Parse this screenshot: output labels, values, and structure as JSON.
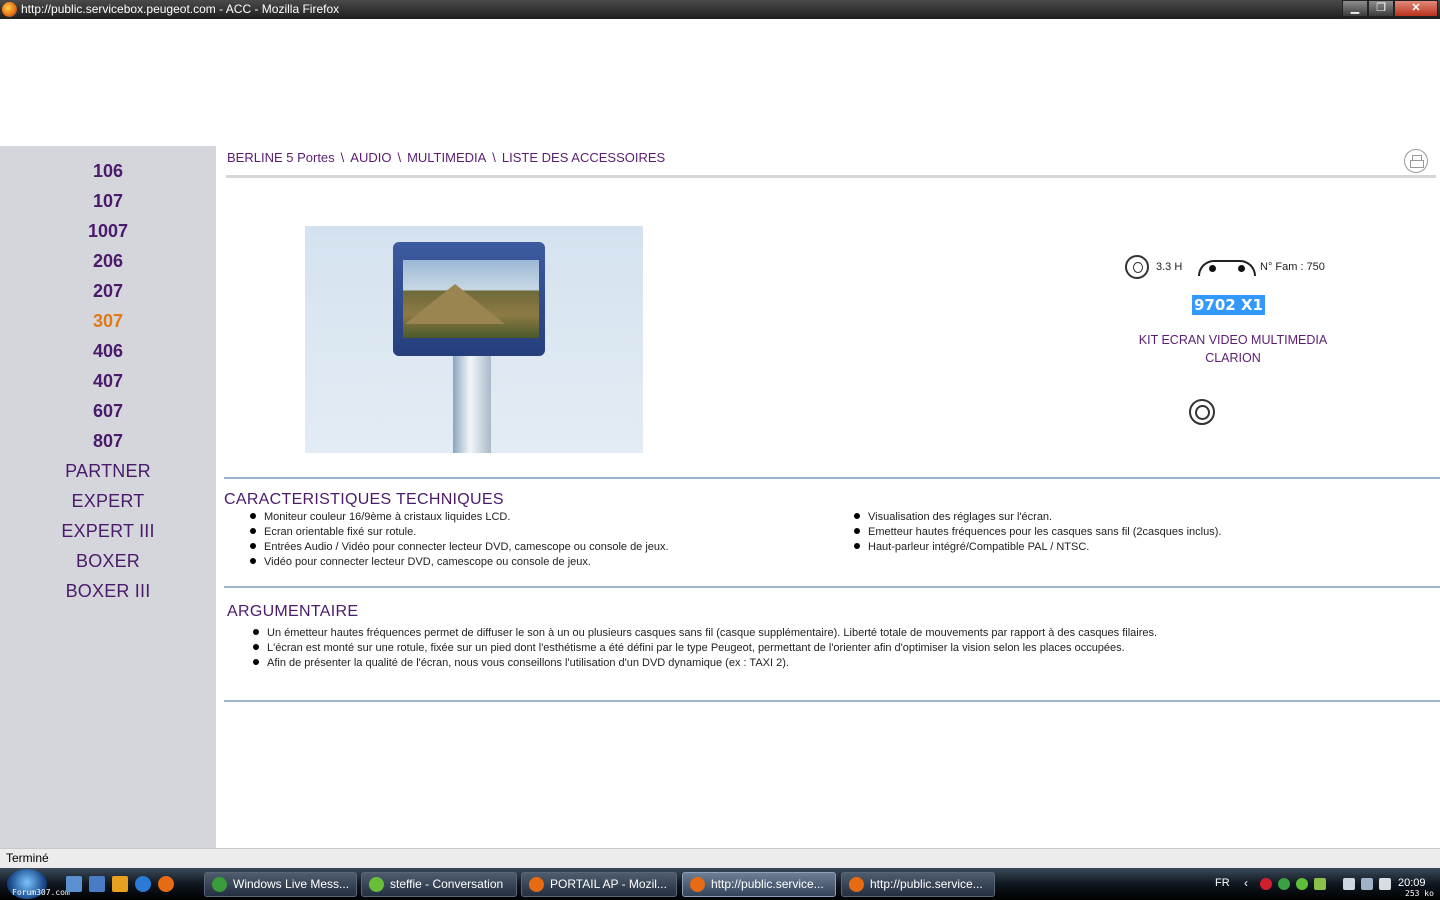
{
  "window": {
    "title": "http://public.servicebox.peugeot.com - ACC - Mozilla Firefox",
    "min": "▁",
    "max": "❐",
    "close": "✕"
  },
  "sidebar": {
    "items": [
      {
        "label": "106",
        "active": false
      },
      {
        "label": "107",
        "active": false
      },
      {
        "label": "1007",
        "active": false
      },
      {
        "label": "206",
        "active": false
      },
      {
        "label": "207",
        "active": false
      },
      {
        "label": "307",
        "active": true
      },
      {
        "label": "406",
        "active": false
      },
      {
        "label": "407",
        "active": false
      },
      {
        "label": "607",
        "active": false
      },
      {
        "label": "807",
        "active": false
      },
      {
        "label": "PARTNER",
        "active": false
      },
      {
        "label": "EXPERT",
        "active": false
      },
      {
        "label": "EXPERT III",
        "active": false
      },
      {
        "label": "BOXER",
        "active": false
      },
      {
        "label": "BOXER III",
        "active": false
      }
    ]
  },
  "breadcrumb": {
    "items": [
      "BERLINE 5 Portes",
      "AUDIO",
      "MULTIMEDIA",
      "LISTE DES ACCESSOIRES"
    ],
    "separator": "\\"
  },
  "product": {
    "time": "3.3 H",
    "family": "N° Fam : 750",
    "reference": "9702 X1",
    "name_line1": "KIT ECRAN VIDEO MULTIMEDIA",
    "name_line2": "CLARION"
  },
  "caracteristiques": {
    "title": "CARACTERISTIQUES TECHNIQUES",
    "left": [
      "Moniteur couleur 16/9ème à cristaux liquides LCD.",
      "Ecran orientable fixé sur rotule.",
      "Entrées Audio / Vidéo pour connecter lecteur DVD, camescope ou console de jeux.",
      "Vidéo pour connecter lecteur DVD, camescope ou console de jeux."
    ],
    "right": [
      "Visualisation des réglages sur l'écran.",
      "Emetteur hautes fréquences pour les casques sans fil (2casques inclus).",
      "Haut-parleur intégré/Compatible PAL / NTSC."
    ]
  },
  "argumentaire": {
    "title": "ARGUMENTAIRE",
    "items": [
      "Un émetteur hautes fréquences permet de diffuser le son à un ou plusieurs casques sans fil (casque supplémentaire). Liberté totale de mouvements par rapport à des casques filaires.",
      "L'écran est monté sur une rotule, fixée sur un pied dont l'esthétisme a été défini par le type Peugeot, permettant de l'orienter afin d'optimiser la vision selon les places occupées.",
      "Afin de présenter la qualité de l'écran, nous vous conseillons l'utilisation d'un DVD dynamique (ex : TAXI 2)."
    ]
  },
  "status": "Terminé",
  "taskbar": {
    "watermark": "Forum307.com",
    "tasks": [
      {
        "label": "Windows Live Mess...",
        "active": false,
        "icon_color": "#3a9c3a"
      },
      {
        "label": "steffie - Conversation",
        "active": false,
        "icon_color": "#6abf3a"
      },
      {
        "label": "PORTAIL AP - Mozil...",
        "active": false,
        "icon_color": "#e66b12"
      },
      {
        "label": "http://public.service...",
        "active": true,
        "icon_color": "#e66b12"
      },
      {
        "label": "http://public.service...",
        "active": false,
        "icon_color": "#e66b12"
      }
    ],
    "lang": "FR",
    "time": "20:09",
    "size": "253 ko"
  }
}
